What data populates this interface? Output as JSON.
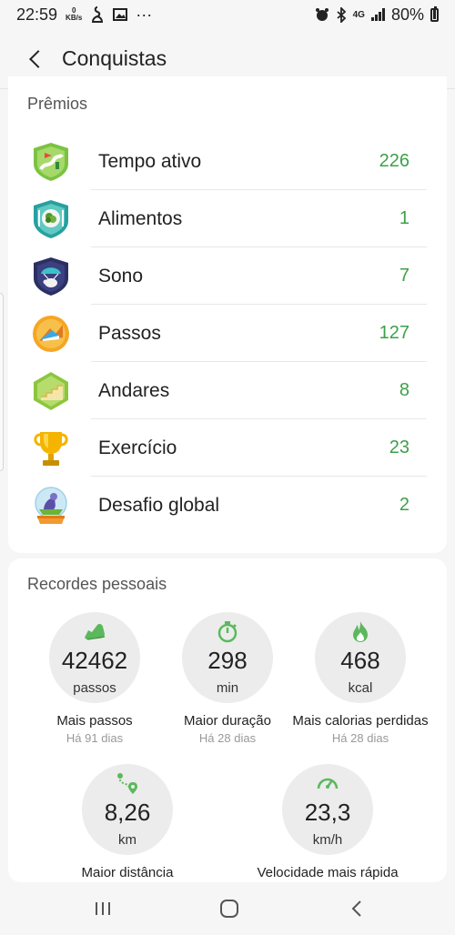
{
  "status_bar": {
    "time": "22:59",
    "net_speed_top": "0",
    "net_speed_bottom": "KB/s",
    "more": "···",
    "network": "4G",
    "battery": "80%"
  },
  "header": {
    "title": "Conquistas"
  },
  "awards": {
    "title": "Prêmios",
    "items": [
      {
        "label": "Tempo ativo",
        "count": "226",
        "icon": "active-time-badge-icon"
      },
      {
        "label": "Alimentos",
        "count": "1",
        "icon": "food-badge-icon"
      },
      {
        "label": "Sono",
        "count": "7",
        "icon": "sleep-badge-icon"
      },
      {
        "label": "Passos",
        "count": "127",
        "icon": "steps-badge-icon"
      },
      {
        "label": "Andares",
        "count": "8",
        "icon": "floors-badge-icon"
      },
      {
        "label": "Exercício",
        "count": "23",
        "icon": "trophy-icon"
      },
      {
        "label": "Desafio global",
        "count": "2",
        "icon": "global-challenge-badge-icon"
      }
    ]
  },
  "records": {
    "title": "Recordes pessoais",
    "items": [
      {
        "value": "42462",
        "unit": "passos",
        "label": "Mais passos",
        "sub": "Há 91 dias",
        "icon": "shoe-icon"
      },
      {
        "value": "298",
        "unit": "min",
        "label": "Maior duração",
        "sub": "Há 28 dias",
        "icon": "stopwatch-icon"
      },
      {
        "value": "468",
        "unit": "kcal",
        "label": "Mais calorias perdidas",
        "sub": "Há 28 dias",
        "icon": "flame-icon"
      },
      {
        "value": "8,26",
        "unit": "km",
        "label": "Maior distância",
        "sub": "",
        "icon": "route-icon"
      },
      {
        "value": "23,3",
        "unit": "km/h",
        "label": "Velocidade mais rápida",
        "sub": "",
        "icon": "speedometer-icon"
      }
    ]
  },
  "colors": {
    "accent_green": "#3da04a",
    "icon_green": "#5cb85c"
  }
}
